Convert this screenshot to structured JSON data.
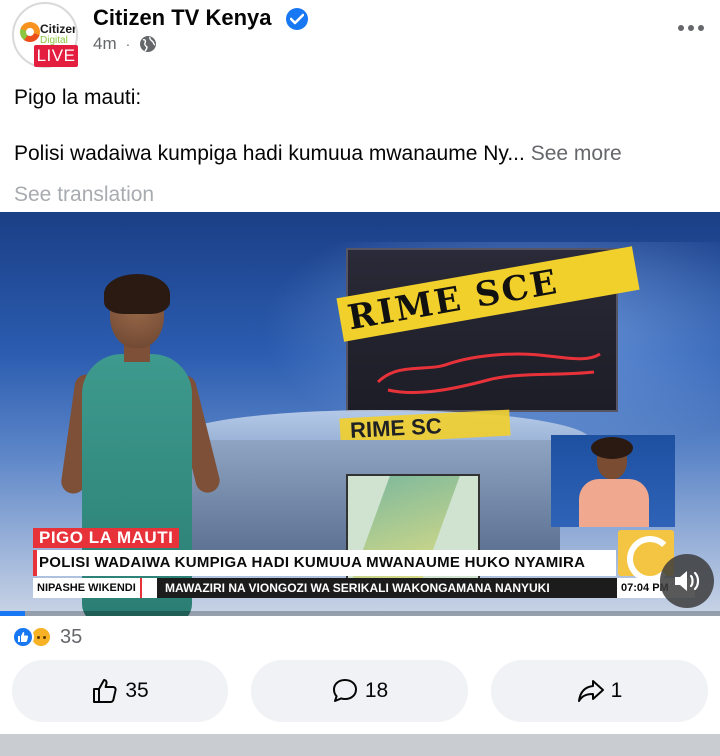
{
  "post": {
    "page_name": "Citizen TV Kenya",
    "time": "4m",
    "dot": "·",
    "avatar": {
      "brand_top": "Citizen",
      "brand_bottom": "Digital",
      "live_badge": "LIVE"
    },
    "headline": "Pigo la mauti:",
    "body": "Polisi wadaiwa kumpiga hadi kumuua mwanaume Ny...",
    "see_more": " See more",
    "see_translation": "See translation"
  },
  "video": {
    "scene_tape": "RIME SCE",
    "desk_tape": "RIME SC",
    "lower_third_label": "PIGO LA MAUTI",
    "lower_third_headline": "POLISI WADAIWA KUMPIGA HADI KUMUUA MWANAUME HUKO NYAMIRA",
    "ticker_label": "NIPASHE WIKENDI",
    "ticker_text": "MAWAZIRI NA VIONGOZI WA SERIKALI WAKONGAMANA NANYUKI",
    "ticker_time": "07:04 PM",
    "progress_fraction": 0.035
  },
  "reactions": {
    "count": "35",
    "types": [
      "like-icon",
      "sad-icon"
    ]
  },
  "actions": {
    "like_count": "35",
    "comment_count": "18",
    "share_count": "1"
  },
  "colors": {
    "accent": "#1877f2",
    "live_red": "#e41e3f",
    "muted_text": "#65676b",
    "button_bg": "#f0f2f5"
  }
}
